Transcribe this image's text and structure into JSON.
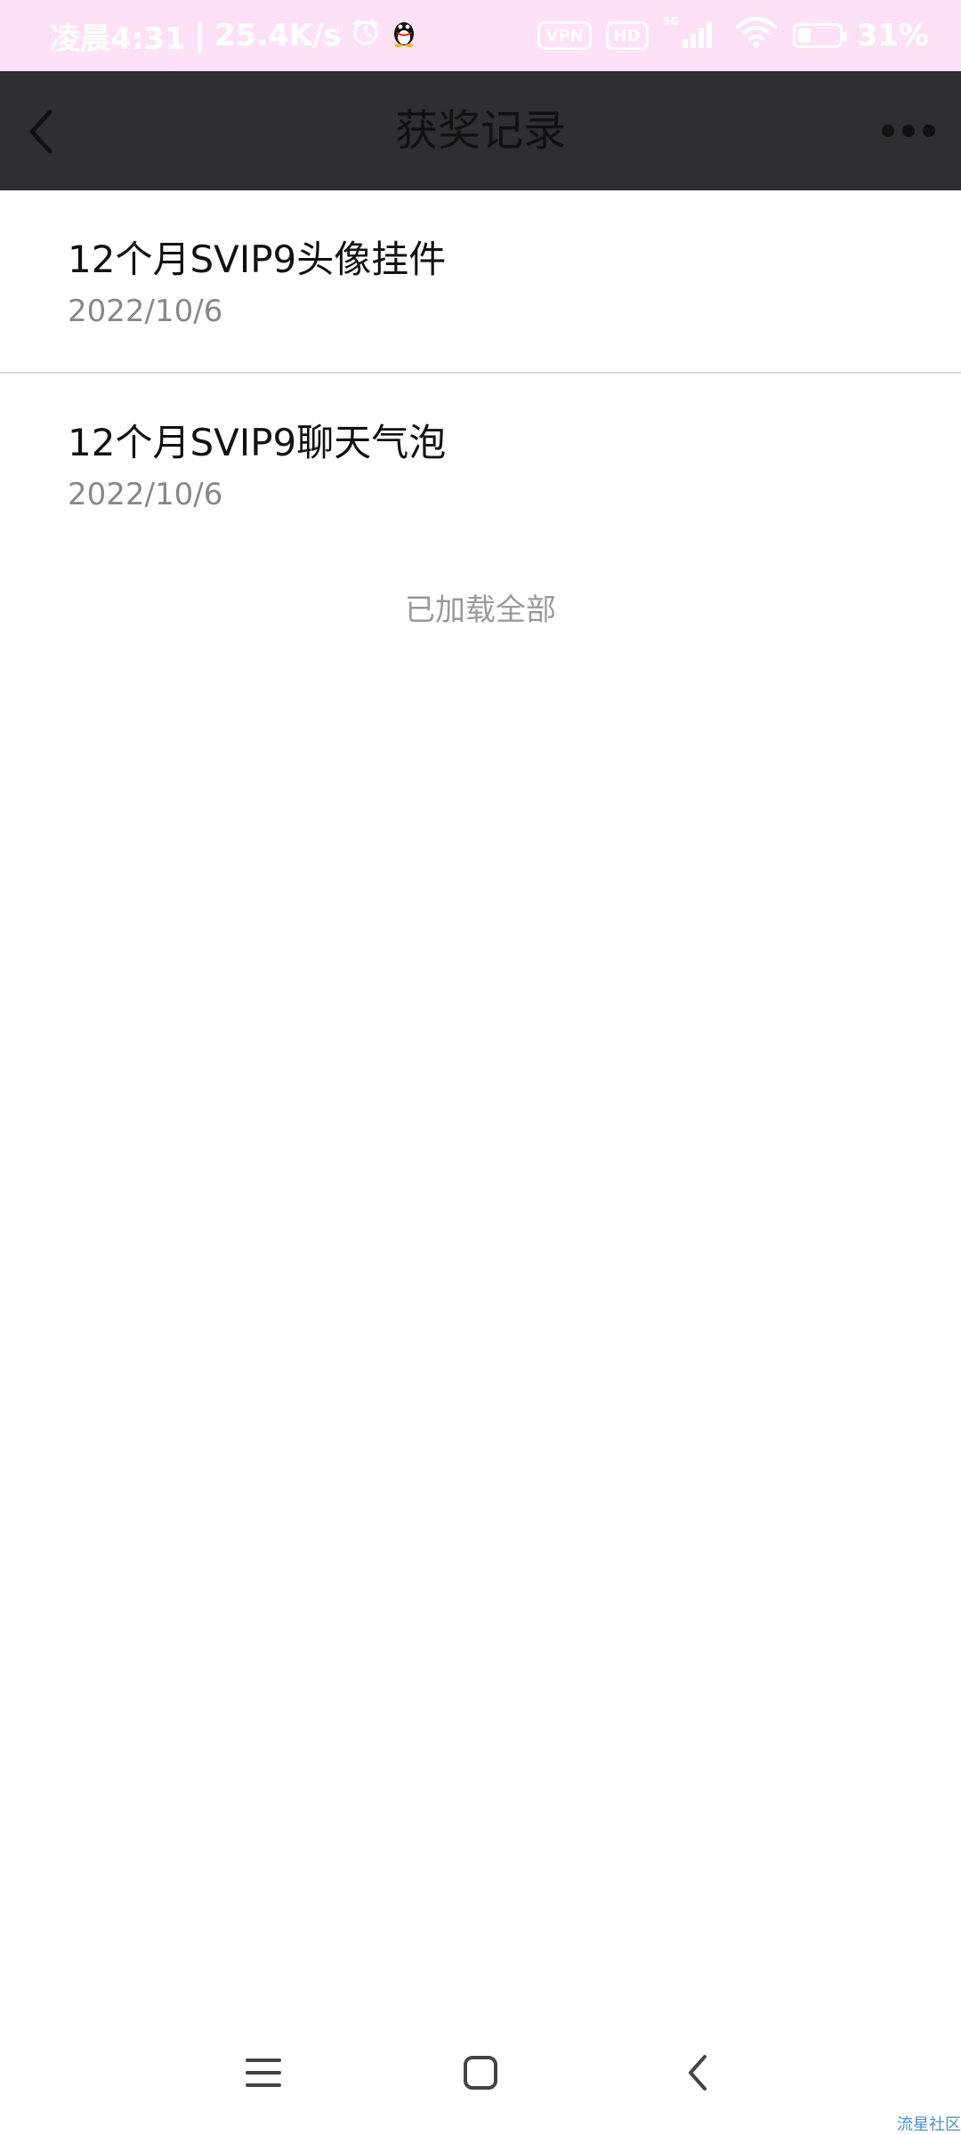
{
  "status_bar": {
    "time": "凌晨4:31",
    "speed": "25.4K/s",
    "vpn": "VPN",
    "hd": "HD",
    "network": "5G",
    "battery": "31%",
    "battery_level": 0.31
  },
  "header": {
    "title": "获奖记录"
  },
  "records": [
    {
      "title": "12个月SVIP9头像挂件",
      "date": "2022/10/6"
    },
    {
      "title": "12个月SVIP9聊天气泡",
      "date": "2022/10/6"
    }
  ],
  "footer_note": "已加载全部",
  "watermark": "流星社区"
}
